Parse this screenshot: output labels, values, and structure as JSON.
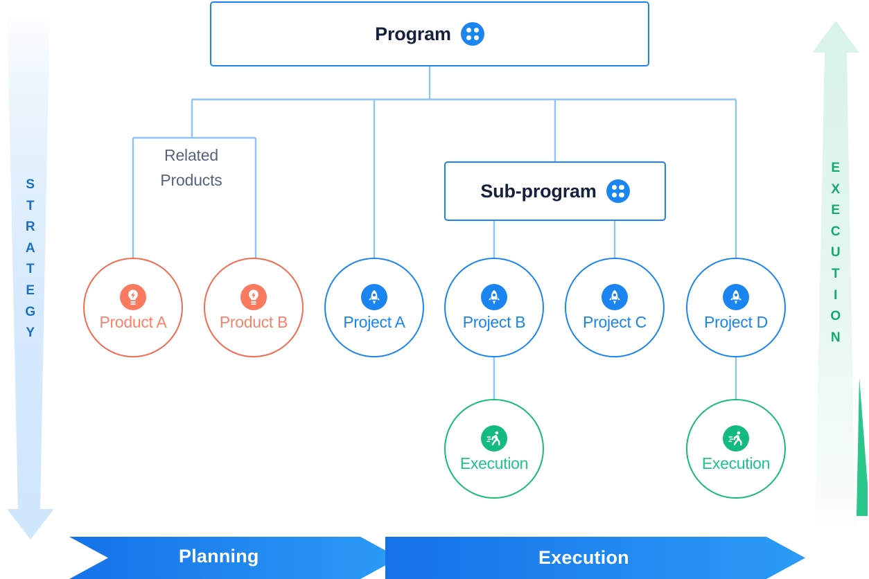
{
  "diagram": {
    "title_nodes": {
      "program": {
        "label": "Program",
        "icon": "four-dots-icon",
        "color": "#1a84f0"
      },
      "subprogram": {
        "label": "Sub-program",
        "icon": "four-dots-icon",
        "color": "#1a84f0"
      }
    },
    "group_label": {
      "line1": "Related",
      "line2": "Products",
      "color": "#58627a"
    },
    "nodes": [
      {
        "id": "product-a",
        "label": "Product A",
        "icon": "lightbulb-bolt-icon",
        "kind": "product",
        "color": "#f4694f"
      },
      {
        "id": "product-b",
        "label": "Product B",
        "icon": "lightbulb-bolt-icon",
        "kind": "product",
        "color": "#f4694f"
      },
      {
        "id": "project-a",
        "label": "Project A",
        "icon": "rocket-icon",
        "kind": "project",
        "color": "#1a84f0"
      },
      {
        "id": "project-b",
        "label": "Project B",
        "icon": "rocket-icon",
        "kind": "project",
        "color": "#1a84f0"
      },
      {
        "id": "project-c",
        "label": "Project C",
        "icon": "rocket-icon",
        "kind": "project",
        "color": "#1a84f0"
      },
      {
        "id": "project-d",
        "label": "Project D",
        "icon": "rocket-icon",
        "kind": "project",
        "color": "#1a84f0"
      },
      {
        "id": "execution-b",
        "label": "Execution",
        "icon": "runner-icon",
        "kind": "execution",
        "color": "#17ba79"
      },
      {
        "id": "execution-d",
        "label": "Execution",
        "icon": "runner-icon",
        "kind": "execution",
        "color": "#17ba79"
      }
    ],
    "side_arrows": {
      "left": {
        "text": "STRATEGY",
        "letters": [
          "S",
          "T",
          "R",
          "A",
          "T",
          "E",
          "G",
          "Y"
        ],
        "direction": "down",
        "color": "#1b6fc0"
      },
      "right": {
        "text": "EXECUTION",
        "letters": [
          "E",
          "X",
          "E",
          "C",
          "U",
          "T",
          "I",
          "O",
          "N"
        ],
        "direction": "up",
        "color": "#16a86f"
      }
    },
    "phase_banners": [
      {
        "id": "planning",
        "label": "Planning",
        "color": "#1b7fef"
      },
      {
        "id": "execution",
        "label": "Execution",
        "color": "#1b7fef"
      }
    ],
    "connector_color": "#8dc3f5"
  }
}
